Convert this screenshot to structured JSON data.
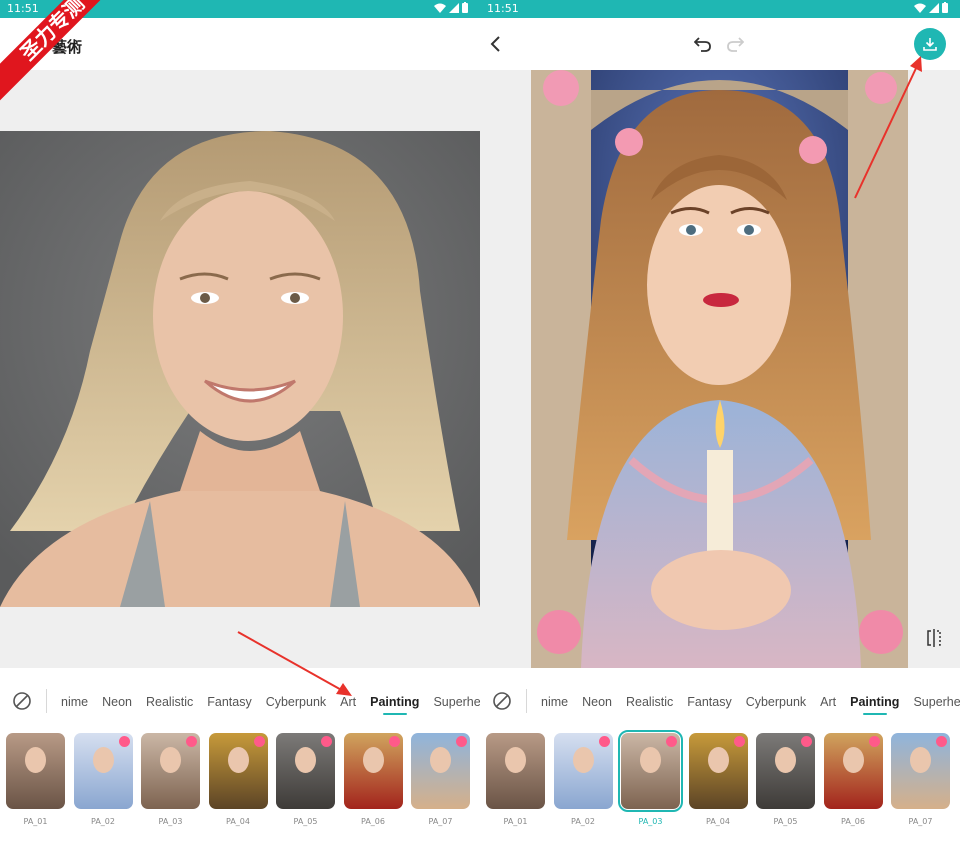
{
  "status": {
    "time": "11:51"
  },
  "left": {
    "title": "藝術",
    "banner": "圣力专测"
  },
  "tabs": [
    "nime",
    "Neon",
    "Realistic",
    "Fantasy",
    "Cyberpunk",
    "Art",
    "Painting",
    "Superhero"
  ],
  "active_tab": "Painting",
  "thumbs": [
    "PA_01",
    "PA_02",
    "PA_03",
    "PA_04",
    "PA_05",
    "PA_06",
    "PA_07"
  ],
  "selected_thumb_right": "PA_03",
  "colors": {
    "accent": "#1fb7b3",
    "annotation_arrow": "#e8322b",
    "banner": "#e0161e"
  }
}
